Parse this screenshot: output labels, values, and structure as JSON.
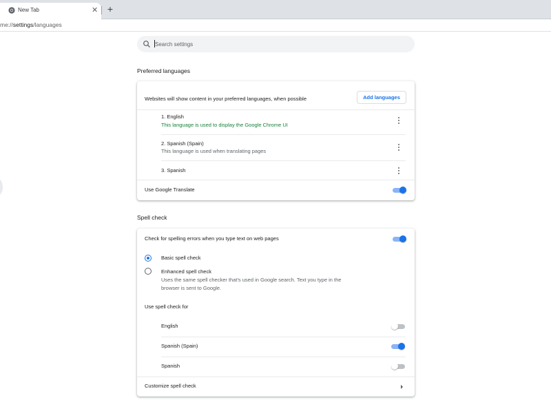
{
  "browser": {
    "tab_title": "New Tab",
    "url_scheme_part": "me://",
    "url_path": "settings",
    "url_rest": "/languages"
  },
  "search": {
    "placeholder": "Search settings"
  },
  "preferred_languages": {
    "title": "Preferred languages",
    "description": "Websites will show content in your preferred languages, when possible",
    "add_button": "Add languages",
    "languages": [
      {
        "name": "1. English",
        "note": "This language is used to display the Google Chrome UI"
      },
      {
        "name": "2. Spanish (Spain)",
        "note": "This language is used when translating pages"
      },
      {
        "name": "3. Spanish",
        "note": ""
      }
    ],
    "translate_label": "Use Google Translate",
    "translate_enabled": true
  },
  "spell_check": {
    "title": "Spell check",
    "main_label": "Check for spelling errors when you type text on web pages",
    "main_enabled": true,
    "basic_label": "Basic spell check",
    "enhanced_label": "Enhanced spell check",
    "enhanced_desc_line1": "Uses the same spell checker that's used in Google search. Text you type in the",
    "enhanced_desc_line2": "browser is sent to Google.",
    "selected_mode": "basic",
    "use_for_label": "Use spell check for",
    "languages": [
      {
        "name": "English",
        "enabled": false
      },
      {
        "name": "Spanish (Spain)",
        "enabled": true
      },
      {
        "name": "Spanish",
        "enabled": false
      }
    ],
    "customize_label": "Customize spell check"
  },
  "colors": {
    "accent": "#1a73e8",
    "green_note": "#188038"
  }
}
